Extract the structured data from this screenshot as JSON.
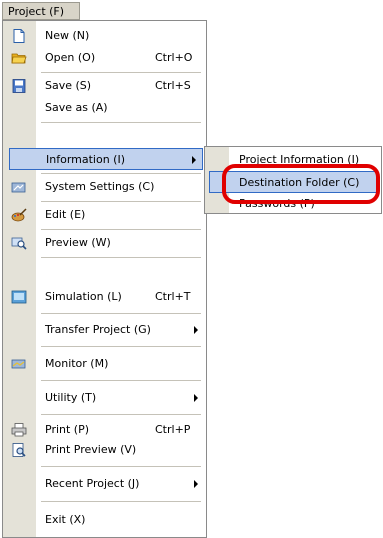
{
  "menubar": {
    "title": "Project (F)"
  },
  "menu": {
    "items": [
      {
        "label": "New (N)",
        "shortcut": "",
        "icon": "new-file-icon"
      },
      {
        "label": "Open (O)",
        "shortcut": "Ctrl+O",
        "icon": "open-folder-icon"
      },
      {
        "label": "Save (S)",
        "shortcut": "Ctrl+S",
        "icon": "save-icon"
      },
      {
        "label": "Save as (A)",
        "shortcut": ""
      },
      {
        "label": "Information (I)",
        "shortcut": "",
        "submenu": true
      },
      {
        "label": "System Settings (C)",
        "shortcut": "",
        "icon": "system-settings-icon"
      },
      {
        "label": "Edit (E)",
        "shortcut": "",
        "icon": "edit-icon"
      },
      {
        "label": "Preview (W)",
        "shortcut": "",
        "icon": "preview-icon"
      },
      {
        "label": "Simulation  (L)",
        "shortcut": "Ctrl+T",
        "icon": "simulation-icon"
      },
      {
        "label": "Transfer Project (G)",
        "shortcut": "",
        "submenu": true
      },
      {
        "label": "Monitor (M)",
        "shortcut": "",
        "icon": "monitor-icon"
      },
      {
        "label": "Utility (T)",
        "shortcut": "",
        "submenu": true
      },
      {
        "label": "Print  (P)",
        "shortcut": "Ctrl+P",
        "icon": "print-icon"
      },
      {
        "label": "Print Preview (V)",
        "shortcut": "",
        "icon": "print-preview-icon"
      },
      {
        "label": "Recent Project (J)",
        "shortcut": "",
        "submenu": true
      },
      {
        "label": "Exit (X)",
        "shortcut": ""
      }
    ]
  },
  "submenu": {
    "items": [
      {
        "label": "Project Information (I)"
      },
      {
        "label": "Destination Folder (C)"
      },
      {
        "label": "Passwords (P)"
      }
    ]
  },
  "colors": {
    "highlight_bg": "#c1d2ee",
    "highlight_border": "#316ac5",
    "gutter": "#e4e2d8",
    "callout": "#e00000"
  }
}
